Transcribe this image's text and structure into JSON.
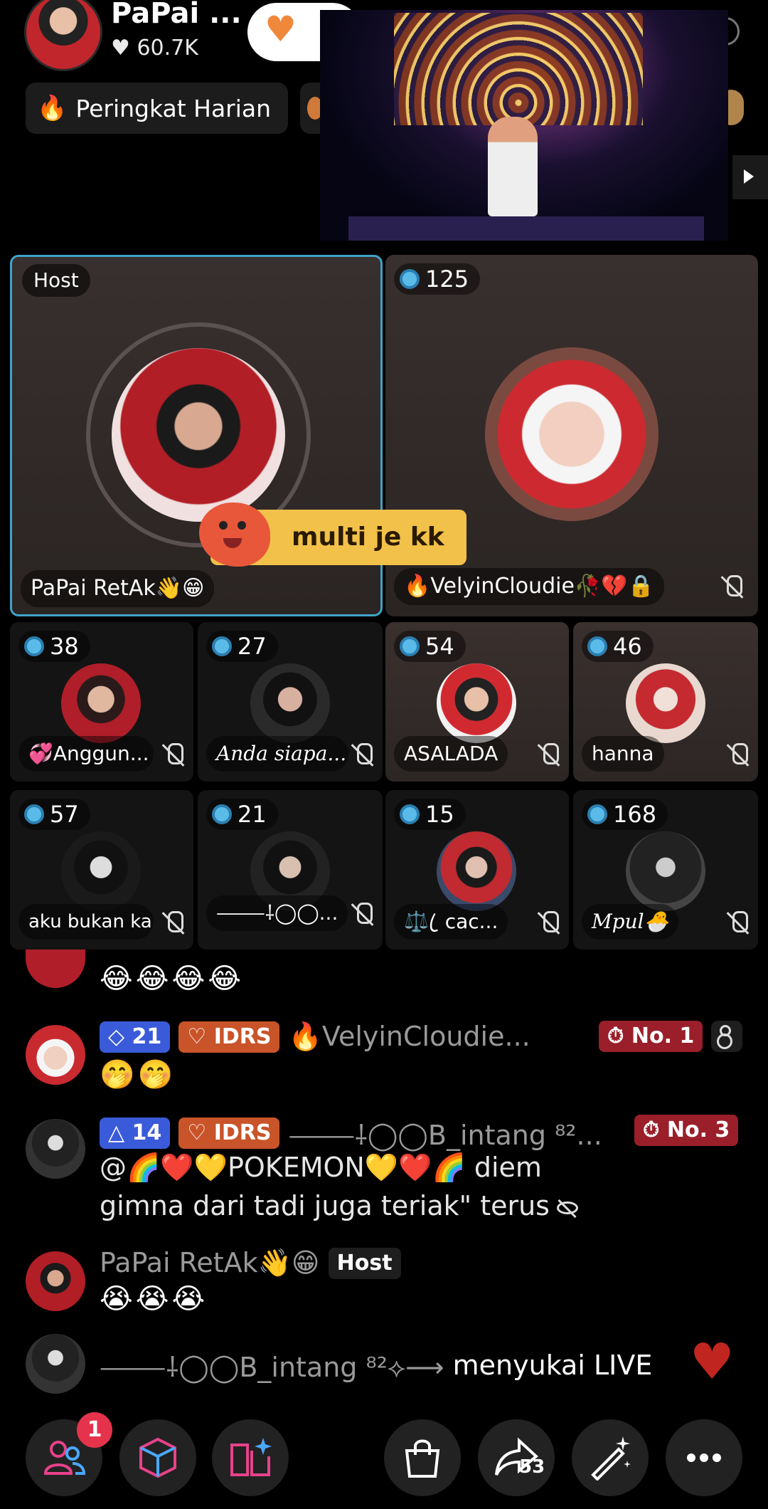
{
  "header": {
    "host_name": "PaPai ...",
    "likes": "60.7K",
    "rank_label": "Peringkat Harian"
  },
  "colors": {
    "accent_host_border": "#3fa3c8",
    "follow_heart": "#f0883c",
    "notification_badge": "#e5334b",
    "gift_bubble": "#f2c14a"
  },
  "grid": {
    "host_tile": {
      "tag": "Host",
      "name": "PaPai RetAk👋😁"
    },
    "cohost_tile": {
      "score": "125",
      "name": "🔥VelyinCloudie🥀💔🔒"
    },
    "gift_bubble_text": "multi je kk",
    "guests": [
      {
        "score": "38",
        "name": "💞Anggun..."
      },
      {
        "score": "27",
        "name": "Anda siapa..."
      },
      {
        "score": "54",
        "name": "ASALADA"
      },
      {
        "score": "46",
        "name": "hanna"
      },
      {
        "score": "57",
        "name": "aku bukan ka..."
      },
      {
        "score": "21",
        "name": "⸻⸸◯◯..."
      },
      {
        "score": "15",
        "name": "⚖️ ꦿ cac..."
      },
      {
        "score": "168",
        "name": "Mpul🐣"
      }
    ]
  },
  "chat": {
    "partial_emojis": "😂😂😂😂",
    "messages": [
      {
        "level": "21",
        "team": "IDRS",
        "name": "🔥VelyinCloudie...",
        "rank": "No. 1",
        "lines": [
          "🤭🤭"
        ]
      },
      {
        "level": "14",
        "team": "IDRS",
        "name": "⸻⸸◯◯B_intang ⁸²...",
        "rank": "No. 3",
        "lines": [
          "@🌈❤️💛POKEMON💛❤️🌈 diem",
          "gimna dari tadi juga teriak\" terus"
        ]
      },
      {
        "name": "PaPai RetAk👋😁",
        "tag": "Host",
        "lines": [
          "😭😭😭"
        ]
      }
    ],
    "like_event": {
      "name": "⸻⸸◯◯B_intang ⁸²⟡⟶",
      "text": "menyukai LIVE"
    }
  },
  "bottom_bar": {
    "notification_count": "1",
    "share_count": "53",
    "icons": [
      "people-icon",
      "cube-icon",
      "book-icon",
      "shopping-bag-icon",
      "share-icon",
      "magic-wand-icon",
      "more-icon"
    ]
  }
}
